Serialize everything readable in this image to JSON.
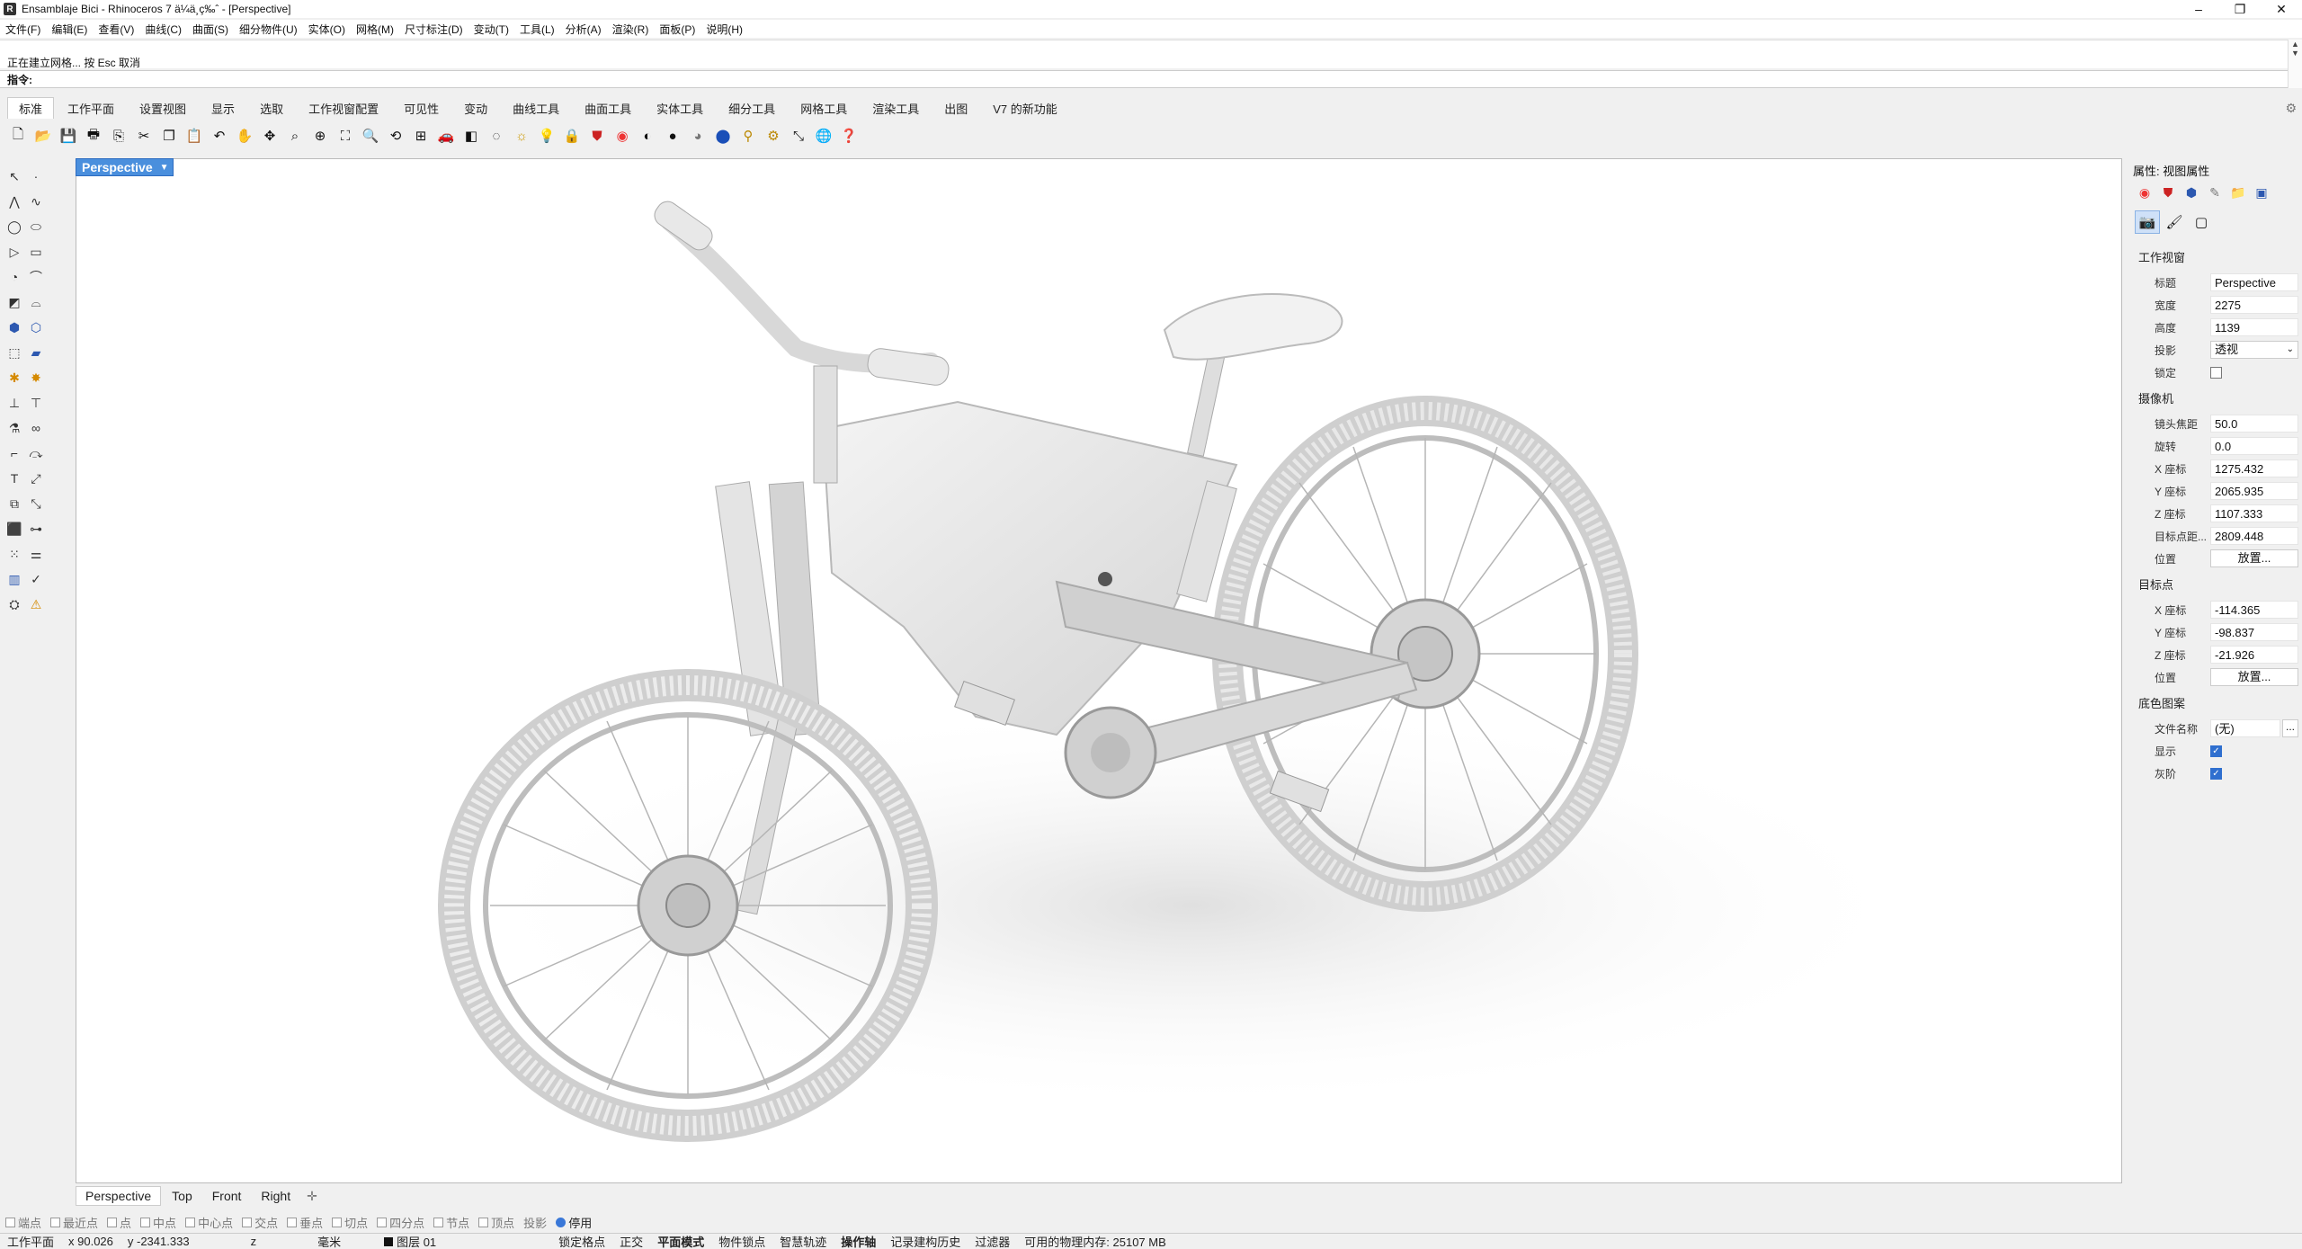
{
  "window": {
    "title": "Ensamblaje Bici - Rhinoceros 7 ä¼ä¸ç‰ˆ - [Perspective]",
    "min": "–",
    "max": "❐",
    "close": "✕"
  },
  "menu": [
    "文件(F)",
    "编辑(E)",
    "查看(V)",
    "曲线(C)",
    "曲面(S)",
    "细分物件(U)",
    "实体(O)",
    "网格(M)",
    "尺寸标注(D)",
    "变动(T)",
    "工具(L)",
    "分析(A)",
    "渲染(R)",
    "面板(P)",
    "说明(H)"
  ],
  "command": {
    "history_line": "正在建立网格... 按 Esc 取消",
    "prompt": "指令:",
    "value": ""
  },
  "toolbar_tabs": [
    "标准",
    "工作平面",
    "设置视图",
    "显示",
    "选取",
    "工作视窗配置",
    "可见性",
    "变动",
    "曲线工具",
    "曲面工具",
    "实体工具",
    "细分工具",
    "网格工具",
    "渲染工具",
    "出图",
    "V7 的新功能"
  ],
  "toolbar_icons": [
    "new-icon",
    "open-icon",
    "save-icon",
    "print-icon",
    "import-icon",
    "cut-icon",
    "copy-icon",
    "paste-icon",
    "undo-icon",
    "pan-icon",
    "rotate-view-icon",
    "zoom-window-icon",
    "zoom-dynamic-icon",
    "zoom-extents-icon",
    "zoom-selected-icon",
    "undo-view-icon",
    "four-viewports-icon",
    "car-icon",
    "layer-icon",
    "circle-icon",
    "options-icon",
    "light-icon",
    "lock-icon",
    "shield-icon",
    "color-wheel-icon",
    "shaded-icon",
    "rendered-icon",
    "sphere-icon",
    "render-icon",
    "settings-icon",
    "gear-icon",
    "transform-icon",
    "globe-icon",
    "help-icon"
  ],
  "viewport": {
    "label": "Perspective"
  },
  "view_tabs": [
    "Perspective",
    "Top",
    "Front",
    "Right"
  ],
  "osnaps": [
    "端点",
    "最近点",
    "点",
    "中点",
    "中心点",
    "交点",
    "垂点",
    "切点",
    "四分点",
    "节点",
    "顶点",
    "投影"
  ],
  "osnap_disable": "停用",
  "status": {
    "cplane": "工作平面",
    "x": "x 90.026",
    "y": "y -2341.333",
    "z": "z",
    "units": "毫米",
    "layer": "图层 01",
    "grid_snap": "锁定格点",
    "ortho": "正交",
    "planar": "平面模式",
    "osnap": "物件锁点",
    "smarttrack": "智慧轨迹",
    "gumball": "操作轴",
    "history": "记录建构历史",
    "filter": "过滤器",
    "memory": "可用的物理内存: 25107 MB"
  },
  "panel": {
    "title": "属性: 视图属性",
    "viewport_section": "工作视窗",
    "title_label": "标题",
    "title_value": "Perspective",
    "width_label": "宽度",
    "width_value": "2275",
    "height_label": "高度",
    "height_value": "1139",
    "projection_label": "投影",
    "projection_value": "透视",
    "locked_label": "锁定",
    "camera_section": "摄像机",
    "lens_label": "镜头焦距",
    "lens_value": "50.0",
    "rotation_label": "旋转",
    "rotation_value": "0.0",
    "cam_x_label": "X 座标",
    "cam_x_value": "1275.432",
    "cam_y_label": "Y 座标",
    "cam_y_value": "2065.935",
    "cam_z_label": "Z 座标",
    "cam_z_value": "1107.333",
    "target_dist_label": "目标点距...",
    "target_dist_value": "2809.448",
    "cam_pos_label": "位置",
    "cam_pos_btn": "放置...",
    "target_section": "目标点",
    "tgt_x_label": "X 座标",
    "tgt_x_value": "-114.365",
    "tgt_y_label": "Y 座标",
    "tgt_y_value": "-98.837",
    "tgt_z_label": "Z 座标",
    "tgt_z_value": "-21.926",
    "tgt_pos_label": "位置",
    "tgt_pos_btn": "放置...",
    "wallpaper_section": "底色图案",
    "file_label": "文件名称",
    "file_value": "(无)",
    "file_btn": "...",
    "show_label": "显示",
    "gray_label": "灰阶"
  }
}
